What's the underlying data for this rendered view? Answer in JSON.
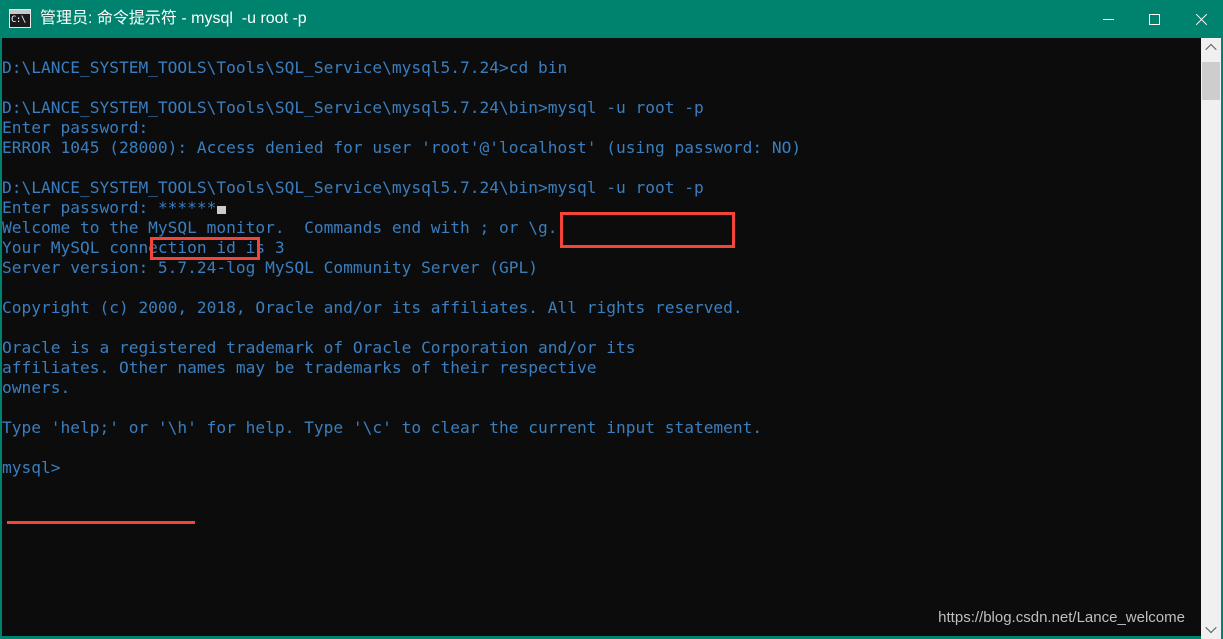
{
  "window": {
    "title": "管理员: 命令提示符 - mysql  -u root -p",
    "icon_name": "cmd-console-icon",
    "icon_label": "C:\\",
    "titlebar_color": "#00836e",
    "background_color": "#0c0c0c",
    "text_color": "#3a7ebf",
    "annotation_color": "#f4453c",
    "controls": {
      "minimize_label": "Minimize",
      "maximize_label": "Maximize",
      "close_label": "Close"
    }
  },
  "console": {
    "lines": [
      "D:\\LANCE_SYSTEM_TOOLS\\Tools\\SQL_Service\\mysql5.7.24>cd bin",
      "",
      "D:\\LANCE_SYSTEM_TOOLS\\Tools\\SQL_Service\\mysql5.7.24\\bin>mysql -u root -p",
      "Enter password:",
      "ERROR 1045 (28000): Access denied for user 'root'@'localhost' (using password: NO)",
      "",
      "D:\\LANCE_SYSTEM_TOOLS\\Tools\\SQL_Service\\mysql5.7.24\\bin>mysql -u root -p",
      "Welcome to the MySQL monitor.  Commands end with ; or \\g.",
      "Your MySQL connection id is 3",
      "Server version: 5.7.24-log MySQL Community Server (GPL)",
      "",
      "Copyright (c) 2000, 2018, Oracle and/or its affiliates. All rights reserved.",
      "",
      "Oracle is a registered trademark of Oracle Corporation and/or its",
      "affiliates. Other names may be trademarks of their respective",
      "owners.",
      "",
      "Type 'help;' or '\\h' for help. Type '\\c' to clear the current input statement.",
      "",
      "mysql>"
    ],
    "password_prompt_label": "Enter password:",
    "password_masked_value": "******"
  },
  "annotations": {
    "command_box_target": "mysql -u root -p",
    "password_box_target": "******",
    "prompt_underline_target": "mysql>"
  },
  "watermark": {
    "text": "https://blog.csdn.net/Lance_welcome"
  },
  "scrollbar": {
    "up_arrow_name": "chevron-up-icon",
    "down_arrow_name": "chevron-down-icon"
  }
}
